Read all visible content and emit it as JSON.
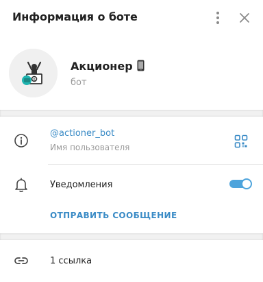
{
  "header": {
    "title": "Информация о боте",
    "menu_icon": "kebab-menu-icon",
    "close_icon": "close-icon"
  },
  "profile": {
    "name": "Акционер",
    "name_icon": "mobile-phone-icon",
    "subtitle": "бот",
    "avatar": "bot-avatar"
  },
  "info": {
    "username": "@actioner_bot",
    "username_caption": "Имя пользователя",
    "info_icon": "info-icon",
    "qr_icon": "qr-code-icon"
  },
  "notifications": {
    "label": "Уведомления",
    "icon": "bell-icon",
    "enabled": true
  },
  "actions": {
    "send_message": "ОТПРАВИТЬ СООБЩЕНИЕ"
  },
  "links": {
    "label": "1 ссылка",
    "icon": "link-icon"
  },
  "colors": {
    "accent": "#3a8bc6",
    "toggle": "#4ea4dc",
    "secondary_text": "#999999",
    "separator": "#f1f1f1"
  }
}
